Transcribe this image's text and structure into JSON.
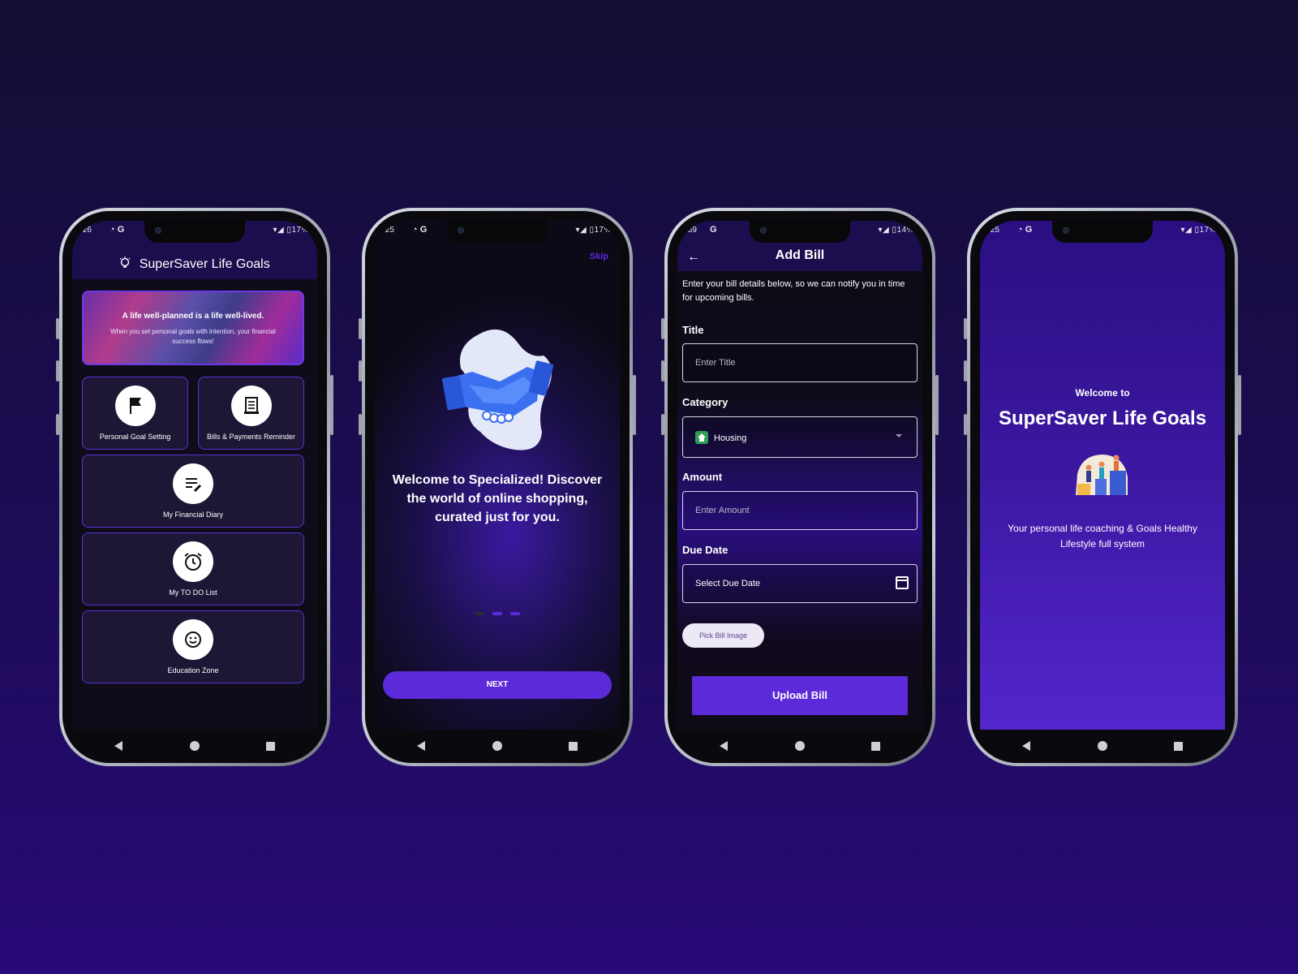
{
  "phones": [
    {
      "status": {
        "time": ":26",
        "right": "17%"
      },
      "app_title": "SuperSaver Life Goals",
      "banner": {
        "headline": "A life well-planned is a life well-lived.",
        "text": "When you set personal goals with intention, your financial success flows!"
      },
      "tiles": [
        {
          "label": "Personal Goal Setting",
          "icon": "flag-icon"
        },
        {
          "label": "Bills & Payments Reminder",
          "icon": "receipt-icon"
        },
        {
          "label": "My Financial Diary",
          "icon": "notes-edit-icon"
        },
        {
          "label": "My TO DO List",
          "icon": "alarm-clock-icon"
        },
        {
          "label": "Education Zone",
          "icon": "smiley-icon"
        }
      ]
    },
    {
      "status": {
        "time": ":25",
        "right": "17%"
      },
      "skip_label": "Skip",
      "welcome_text": "Welcome to Specialized! Discover the world of online shopping, curated just for you.",
      "page_indicator": {
        "count": 3,
        "active": [
          1,
          2
        ]
      },
      "next_label": "NEXT",
      "illustration": "handshake-illustration"
    },
    {
      "status": {
        "time": ":59",
        "right": "14%"
      },
      "title": "Add Bill",
      "intro": "Enter your bill details below, so we can notify you in time for upcoming bills.",
      "fields": {
        "title_label": "Title",
        "title_placeholder": "Enter Title",
        "category_label": "Category",
        "category_value": "Housing",
        "amount_label": "Amount",
        "amount_placeholder": "Enter Amount",
        "due_label": "Due Date",
        "due_value": "Select Due Date"
      },
      "pick_image_label": "Pick Bill Image",
      "upload_label": "Upload Bill"
    },
    {
      "status": {
        "time": ":25",
        "right": "17%"
      },
      "welcome_label": "Welcome to",
      "title": "SuperSaver Life Goals",
      "tagline": "Your personal life coaching & Goals Healthy Lifestyle full system",
      "illustration": "teamwork-illustration"
    }
  ],
  "colors": {
    "accent": "#5c2ad8",
    "appbar": "#1c0e4e",
    "background": "#1c0c55"
  }
}
